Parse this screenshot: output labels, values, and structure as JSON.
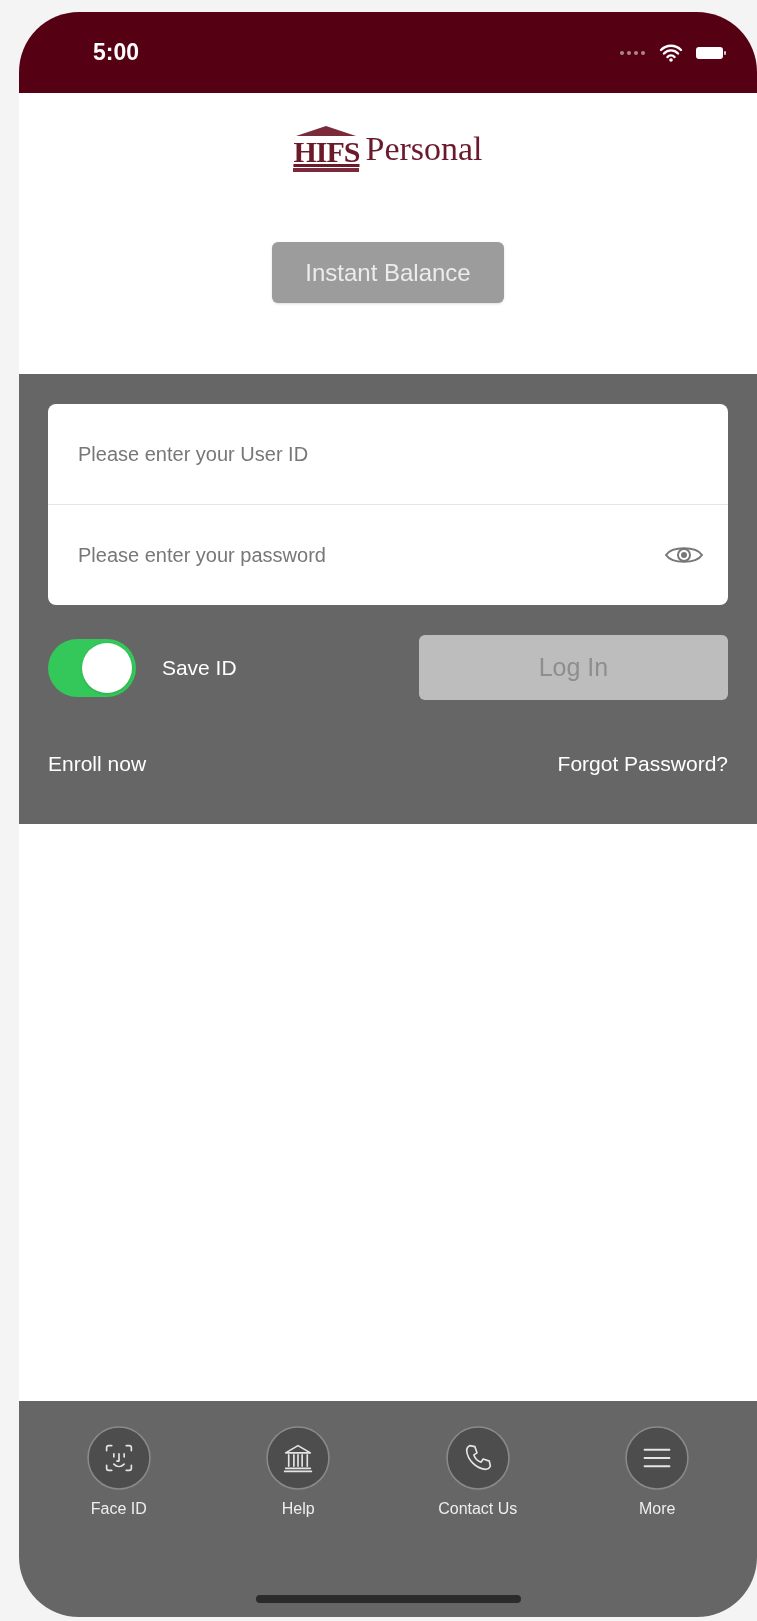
{
  "status_bar": {
    "time": "5:00"
  },
  "logo": {
    "mark": "HIFS",
    "name": "Personal"
  },
  "instant_balance_button": {
    "label": "Instant Balance"
  },
  "login_form": {
    "user_id": {
      "placeholder": "Please enter your User ID"
    },
    "password": {
      "placeholder": "Please enter your password"
    },
    "save_id": {
      "label": "Save ID",
      "on": true
    },
    "login_button": {
      "label": "Log In",
      "disabled": true
    },
    "enroll_link": "Enroll now",
    "forgot_link": "Forgot Password?"
  },
  "tab_bar": [
    {
      "kind": "face",
      "label": "Face ID"
    },
    {
      "kind": "bank",
      "label": "Help"
    },
    {
      "kind": "phone",
      "label": "Contact Us"
    },
    {
      "kind": "menu",
      "label": "More"
    }
  ]
}
